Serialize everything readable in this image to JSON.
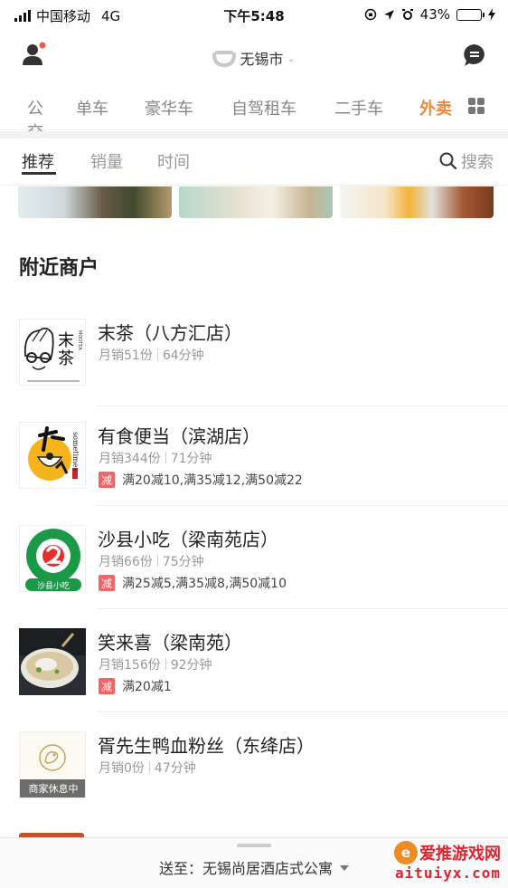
{
  "status": {
    "carrier": "中国移动",
    "network": "4G",
    "time": "下午5:48",
    "battery": "43%",
    "battery_level": 0.43
  },
  "header": {
    "city": "无锡市",
    "avatar_icon": "user-icon",
    "message_icon": "message-icon"
  },
  "service_nav": {
    "items": [
      "公交",
      "单车",
      "豪华车",
      "自驾租车",
      "二手车",
      "外卖"
    ],
    "active": "外卖",
    "accent_color": "#f4883a"
  },
  "sort_tabs": {
    "items": [
      "推荐",
      "销量",
      "时间"
    ],
    "active": "推荐",
    "search_label": "搜索"
  },
  "section_title": "附近商户",
  "stores": [
    {
      "name": "末茶（八方汇店）",
      "sales": "月销51份",
      "time": "64分钟",
      "promo": "",
      "logo_text": "末茶",
      "logo_side": "MOOTEA"
    },
    {
      "name": "有食便当（滨湖店）",
      "sales": "月销344份",
      "time": "71分钟",
      "promo": "满20减10,满35减12,满50减22",
      "logo_text": "有食"
    },
    {
      "name": "沙县小吃（梁南苑店）",
      "sales": "月销66份",
      "time": "75分钟",
      "promo": "满25减5,满35减8,满50减10",
      "logo_text": "沙县小吃",
      "logo_arc": "SHAXIAN DELICACIES"
    },
    {
      "name": "笑来喜（梁南苑）",
      "sales": "月销156份",
      "time": "92分钟",
      "promo": "满20减1"
    },
    {
      "name": "胥先生鸭血粉丝（东绛店）",
      "sales": "月销0份",
      "time": "47分钟",
      "promo": "",
      "closed_label": "商家休息中"
    }
  ],
  "promo_tag": "减",
  "bottom": {
    "deliver_to": "送至：无锡尚居酒店式公寓"
  },
  "watermark": {
    "cn": "爱推游戏网",
    "url": "aituiyx.com",
    "logo_letter": "e"
  }
}
